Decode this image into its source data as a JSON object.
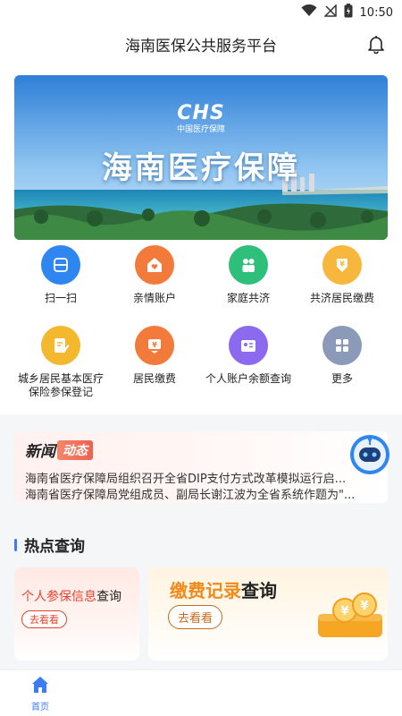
{
  "status_bar": {
    "time": "10:50"
  },
  "header": {
    "title": "海南医保公共服务平台",
    "notification_icon": "bell-icon"
  },
  "banner": {
    "logo_text": "CHS",
    "logo_subtitle": "中国医疗保障",
    "headline": "海南医疗保障"
  },
  "services": [
    {
      "label": "扫一扫",
      "icon": "scan-icon",
      "color": "#2f86f0"
    },
    {
      "label": "亲情账户",
      "icon": "home-heart-icon",
      "color": "#f27a3a"
    },
    {
      "label": "家庭共济",
      "icon": "family-icon",
      "color": "#2ebf7a"
    },
    {
      "label": "共济居民缴费",
      "icon": "coin-down-icon",
      "color": "#f6b73c"
    },
    {
      "label": "城乡居民基本医疗保险参保登记",
      "icon": "edit-doc-icon",
      "color": "#f4b82e"
    },
    {
      "label": "居民缴费",
      "icon": "yuan-download-icon",
      "color": "#f27a3a"
    },
    {
      "label": "个人账户余额查询",
      "icon": "account-card-icon",
      "color": "#8b6af0"
    },
    {
      "label": "更多",
      "icon": "more-grid-icon",
      "color": "#8a9ab8"
    }
  ],
  "news": {
    "brand": "新闻",
    "tag": "动态",
    "items": [
      "海南省医疗保障局组织召开全省DIP支付方式改革模拟运行启...",
      "海南省医疗保障局党组成员、副局长谢江波为全省系统作题为\"..."
    ]
  },
  "hot": {
    "title": "热点查询",
    "card1": {
      "title_accent": "个人参保信息",
      "title_rest": "查询",
      "button": "去看看"
    },
    "card2": {
      "title_accent": "缴费记录",
      "title_rest": "查询",
      "button": "去看看"
    }
  },
  "tabbar": {
    "home_label": "首页"
  }
}
